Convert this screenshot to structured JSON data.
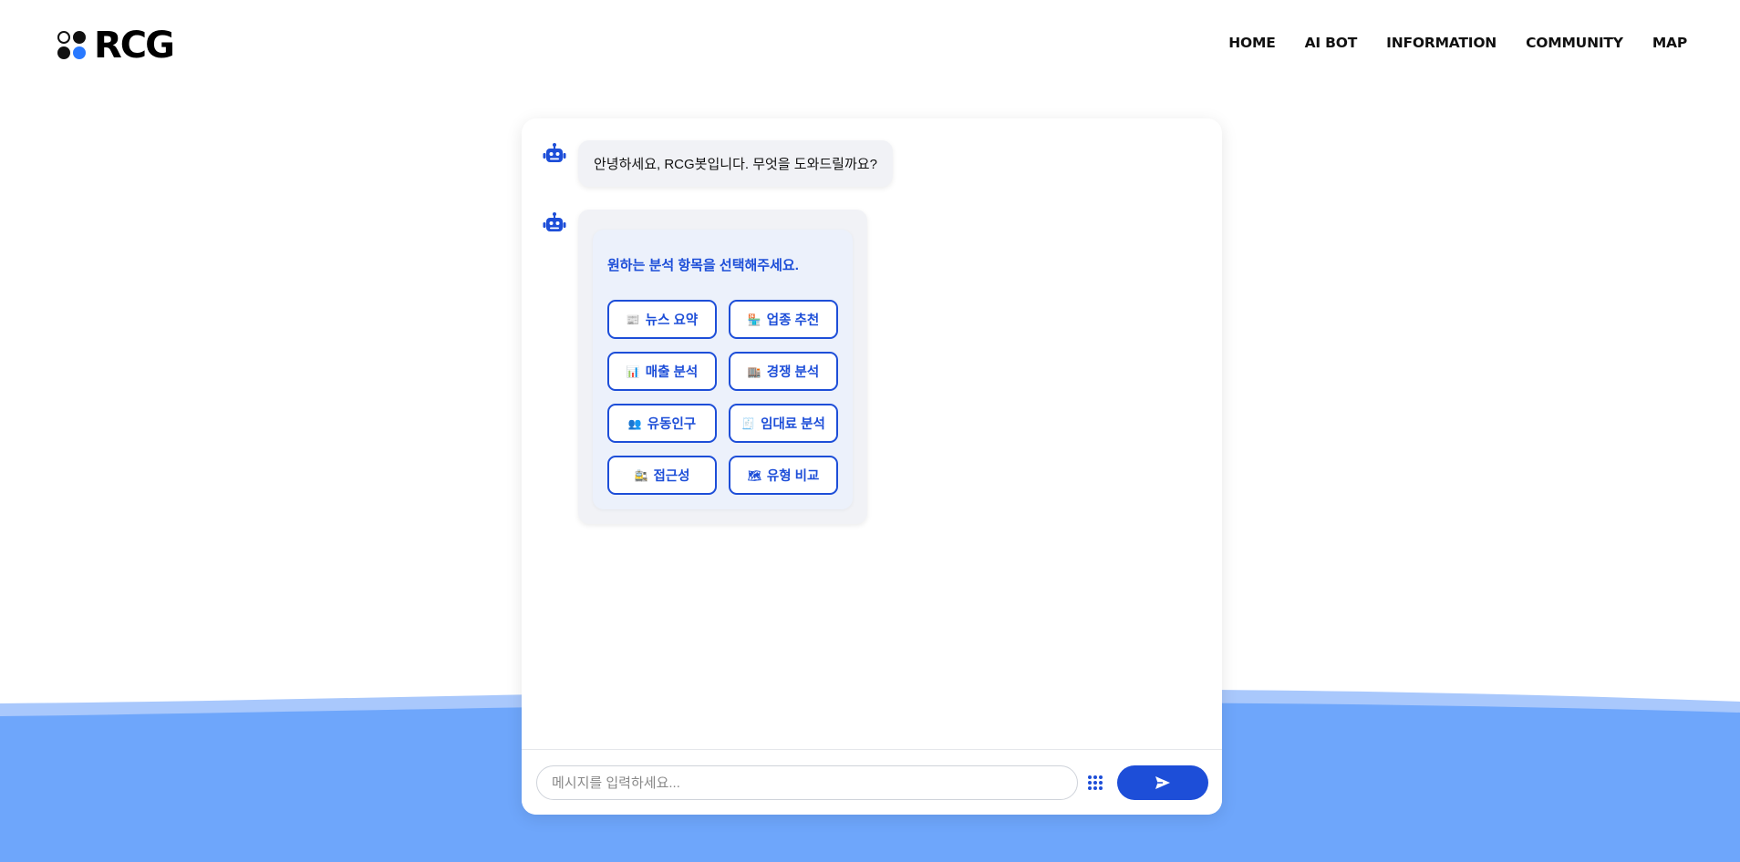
{
  "header": {
    "logo_text": "RCG",
    "nav": [
      "HOME",
      "AI BOT",
      "INFORMATION",
      "COMMUNITY",
      "MAP"
    ]
  },
  "chat": {
    "greeting": "안녕하세요, RCG봇입니다. 무엇을 도와드릴까요?",
    "menu_title": "원하는 분석 항목을 선택해주세요.",
    "options": [
      {
        "icon": "📰",
        "label": "뉴스 요약"
      },
      {
        "icon": "🏪",
        "label": "업종 추천"
      },
      {
        "icon": "📊",
        "label": "매출 분석"
      },
      {
        "icon": "🏬",
        "label": "경쟁 분석"
      },
      {
        "icon": "👥",
        "label": "유동인구"
      },
      {
        "icon": "🧾",
        "label": "임대료 분석"
      },
      {
        "icon": "🚉",
        "label": "접근성"
      },
      {
        "icon": "🗺",
        "label": "유형 비교"
      }
    ],
    "input_placeholder": "메시지를 입력하세요..."
  },
  "colors": {
    "accent": "#1d4ed8",
    "wave": "#6ea6fb",
    "logo_dot": "#2979ff"
  },
  "icons": {
    "bot": "robot-icon",
    "menu_toggle": "grid-dots-icon",
    "send": "paper-plane-icon"
  }
}
